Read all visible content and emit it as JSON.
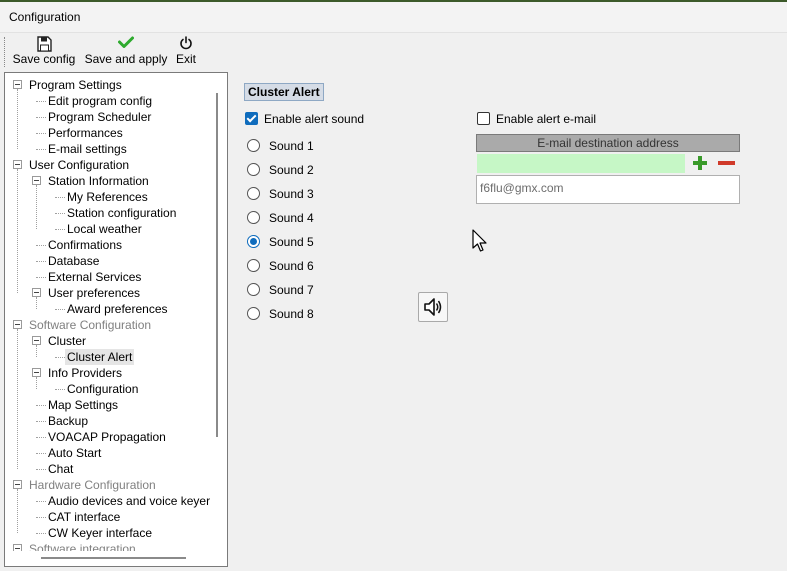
{
  "window": {
    "title": "Configuration"
  },
  "toolbar": {
    "save_config": {
      "label": "Save config",
      "icon": "floppy-disk-icon"
    },
    "save_apply": {
      "label": "Save and apply",
      "icon": "green-check-icon"
    },
    "exit": {
      "label": "Exit",
      "icon": "power-icon"
    }
  },
  "tree": {
    "items": [
      {
        "label": "Program Settings",
        "level": 0,
        "expanded": true,
        "disabled": false
      },
      {
        "label": "Edit program config",
        "level": 1
      },
      {
        "label": "Program Scheduler",
        "level": 1
      },
      {
        "label": "Performances",
        "level": 1
      },
      {
        "label": "E-mail settings",
        "level": 1
      },
      {
        "label": "User Configuration",
        "level": 0,
        "expanded": true,
        "disabled": false
      },
      {
        "label": "Station Information",
        "level": 1,
        "expanded": true
      },
      {
        "label": "My References",
        "level": 2
      },
      {
        "label": "Station configuration",
        "level": 2
      },
      {
        "label": "Local weather",
        "level": 2
      },
      {
        "label": "Confirmations",
        "level": 1
      },
      {
        "label": "Database",
        "level": 1
      },
      {
        "label": "External Services",
        "level": 1
      },
      {
        "label": "User preferences",
        "level": 1,
        "expanded": true
      },
      {
        "label": "Award preferences",
        "level": 2
      },
      {
        "label": "Software Configuration",
        "level": 0,
        "expanded": true,
        "disabled": true
      },
      {
        "label": "Cluster",
        "level": 1,
        "expanded": true
      },
      {
        "label": "Cluster Alert",
        "level": 2,
        "selected": true
      },
      {
        "label": "Info Providers",
        "level": 1,
        "expanded": true
      },
      {
        "label": "Configuration",
        "level": 2
      },
      {
        "label": "Map Settings",
        "level": 1
      },
      {
        "label": "Backup",
        "level": 1
      },
      {
        "label": "VOACAP Propagation",
        "level": 1
      },
      {
        "label": "Auto Start",
        "level": 1
      },
      {
        "label": "Chat",
        "level": 1
      },
      {
        "label": "Hardware Configuration",
        "level": 0,
        "expanded": true,
        "disabled": true
      },
      {
        "label": "Audio devices and voice keyer",
        "level": 1
      },
      {
        "label": "CAT interface",
        "level": 1
      },
      {
        "label": "CW Keyer interface",
        "level": 1
      },
      {
        "label": "Software integration",
        "level": 0,
        "expanded": true,
        "disabled": true
      }
    ]
  },
  "panel": {
    "title": "Cluster Alert",
    "enable_sound": {
      "label": "Enable alert sound",
      "checked": true
    },
    "sounds": [
      {
        "label": "Sound 1",
        "selected": false
      },
      {
        "label": "Sound 2",
        "selected": false
      },
      {
        "label": "Sound 3",
        "selected": false
      },
      {
        "label": "Sound 4",
        "selected": false
      },
      {
        "label": "Sound 5",
        "selected": true
      },
      {
        "label": "Sound 6",
        "selected": false
      },
      {
        "label": "Sound 7",
        "selected": false
      },
      {
        "label": "Sound 8",
        "selected": false
      }
    ],
    "speaker_icon": "speaker-icon",
    "enable_email": {
      "label": "Enable alert e-mail",
      "checked": false
    },
    "email_header": "E-mail destination address",
    "email_input_value": "",
    "email_list": [
      "f6flu@gmx.com"
    ]
  },
  "colors": {
    "accent": "#0f6cbd",
    "email_input_bg": "#c6f7c6",
    "add_green": "#3a9a2a",
    "remove_red": "#d03a2a"
  }
}
